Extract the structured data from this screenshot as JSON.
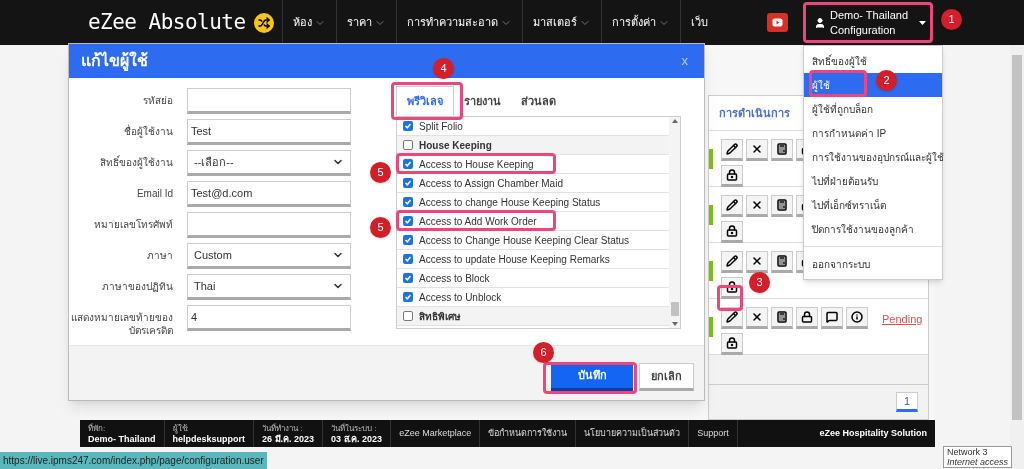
{
  "nav": {
    "brand": "eZee Absolute",
    "menu": [
      {
        "label": "ห้อง",
        "dropdown": true
      },
      {
        "label": "ราคา",
        "dropdown": true
      },
      {
        "label": "การทำความสะอาด",
        "dropdown": true
      },
      {
        "label": "มาสเตอร์",
        "dropdown": true
      },
      {
        "label": "การตั้งค่า",
        "dropdown": true
      },
      {
        "label": "เว็บ",
        "dropdown": false
      }
    ],
    "user_menu": {
      "line_1": "Demo- Thailand",
      "line_2": "Configuration"
    }
  },
  "dropdown_menu": {
    "items": [
      {
        "label": "สิทธิ์ของผู้ใช้",
        "selected": false
      },
      {
        "label": "ผู้ใช้",
        "selected": true
      },
      {
        "label": "ผู้ใช้ที่ถูกบล็อก",
        "selected": false
      },
      {
        "label": "การกำหนดค่า IP",
        "selected": false
      },
      {
        "label": "การใช้งานของอุปกรณ์และผู้ใช้",
        "selected": false
      },
      {
        "label": "ไปที่ฝ่ายต้อนรับ",
        "selected": false
      },
      {
        "label": "ไปที่เอ็กซ์ทราเน็ต",
        "selected": false
      },
      {
        "label": "ปิดการใช้งานของลูกค้า",
        "selected": false
      }
    ],
    "footer_items": [
      {
        "label": "ออกจากระบบ",
        "selected": false
      }
    ]
  },
  "background_table": {
    "header": "การดำเนินการ",
    "rows": [
      {
        "active": true
      },
      {
        "active": true
      },
      {
        "active": true
      },
      {
        "active": true,
        "status": "Pending"
      }
    ],
    "pages": [
      {
        "label": "1",
        "selected": true
      }
    ]
  },
  "modal": {
    "title": "แก้ไขผู้ใช้",
    "close": "x",
    "fields": [
      {
        "label": "รหัสย่อ",
        "kind": "text"
      },
      {
        "label": "ชื่อผู้ใช้งาน",
        "kind": "text",
        "value": "Test"
      },
      {
        "label": "สิทธิ์ของผู้ใช้งาน",
        "kind": "select",
        "value": "--เลือก--"
      },
      {
        "label": "Email Id",
        "kind": "text",
        "value": "Test@d.com"
      },
      {
        "label": "หมายเลขโทรศัพท์",
        "kind": "text"
      },
      {
        "label": "ภาษา",
        "kind": "select",
        "value": "Custom"
      },
      {
        "label": "ภาษาของปฏิทิน",
        "kind": "select",
        "value": "Thai"
      },
      {
        "label": "แสดงหมายเลขท้ายของบัตรเครดิต",
        "kind": "text",
        "value": "4"
      }
    ],
    "tabs": [
      {
        "label": "พรีวิเลจ",
        "selected": true
      },
      {
        "label": "รายงาน",
        "selected": false
      },
      {
        "label": "ส่วนลด",
        "selected": false
      }
    ],
    "privileges": [
      {
        "label": "Split Folio",
        "kind": "item",
        "checked": true
      },
      {
        "label": "House Keeping",
        "kind": "group",
        "checked": false
      },
      {
        "label": "Access to House Keeping",
        "kind": "item",
        "checked": true
      },
      {
        "label": "Access to Assign Chamber Maid",
        "kind": "item",
        "checked": true
      },
      {
        "label": "Access to change House Keeping Status",
        "kind": "item",
        "checked": true
      },
      {
        "label": "Access to Add Work Order",
        "kind": "item",
        "checked": true
      },
      {
        "label": "Access to Change House Keeping Clear Status",
        "kind": "item",
        "checked": true
      },
      {
        "label": "Access to update House Keeping Remarks",
        "kind": "item",
        "checked": true
      },
      {
        "label": "Access to Block",
        "kind": "item",
        "checked": true
      },
      {
        "label": "Access to Unblock",
        "kind": "item",
        "checked": true
      },
      {
        "label": "สิทธิพิเศษ",
        "kind": "group",
        "checked": false
      }
    ],
    "buttons": [
      {
        "label": "บันทึก",
        "kind": "primary"
      },
      {
        "label": "ยกเลิก",
        "kind": "secondary"
      }
    ]
  },
  "footer": {
    "info": [
      {
        "label": "ที่พัก:",
        "value": "Demo- Thailand"
      },
      {
        "label": "ผู้ใช้:",
        "value": "helpdesksupport"
      },
      {
        "label": "วันที่ทำงาน :",
        "value": "26 มี.ค. 2023"
      },
      {
        "label": "วันที่ในระบบ :",
        "value": "03 ส.ค. 2023"
      }
    ],
    "links": [
      "eZee Marketplace",
      "ข้อกำหนดการใช้งาน",
      "นโยบายความเป็นส่วนตัว",
      "Support"
    ],
    "brand": "eZee Hospitality Solution"
  },
  "status_url": "https://live.ipms247.com/index.php/page/configuration.user",
  "network_tooltip": {
    "title": "Network 3",
    "subtitle": "Internet access"
  },
  "annotations": [
    {
      "label": "1"
    },
    {
      "label": "2"
    },
    {
      "label": "3"
    },
    {
      "label": "4"
    },
    {
      "label": "5"
    },
    {
      "label": "5"
    },
    {
      "label": "6"
    }
  ]
}
